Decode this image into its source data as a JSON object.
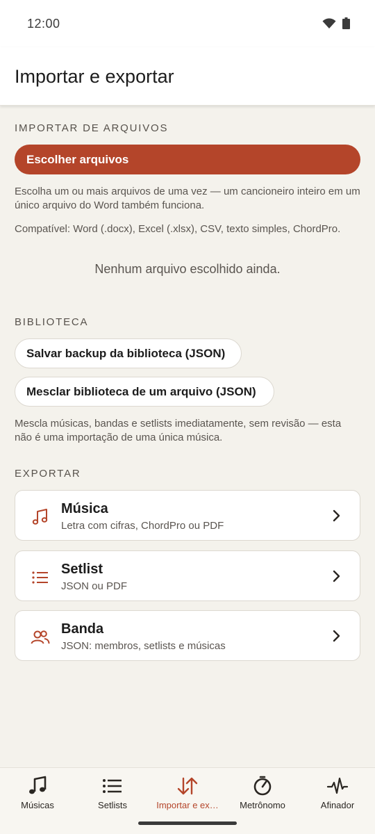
{
  "status": {
    "time": "12:00"
  },
  "appbar": {
    "title": "Importar e exportar"
  },
  "import": {
    "section_label": "IMPORTAR DE ARQUIVOS",
    "choose_button": "Escolher arquivos",
    "help_text": "Escolha um ou mais arquivos de uma vez — um cancioneiro inteiro em um único arquivo do Word também funciona.",
    "compat_text": "Compatível: Word (.docx), Excel (.xlsx), CSV, texto simples, ChordPro.",
    "empty_state": "Nenhum arquivo escolhido ainda."
  },
  "library": {
    "section_label": "BIBLIOTECA",
    "backup_button": "Salvar backup da biblioteca (JSON)",
    "merge_button": "Mesclar biblioteca de um arquivo (JSON)",
    "note": "Mescla músicas, bandas e setlists imediatamente, sem revisão — esta não é uma importação de uma única música."
  },
  "export": {
    "section_label": "EXPORTAR",
    "items": [
      {
        "title": "Música",
        "subtitle": "Letra com cifras, ChordPro ou PDF",
        "icon": "music-note-icon"
      },
      {
        "title": "Setlist",
        "subtitle": "JSON ou PDF",
        "icon": "list-icon"
      },
      {
        "title": "Banda",
        "subtitle": "JSON: membros, setlists e músicas",
        "icon": "people-icon"
      }
    ]
  },
  "nav": {
    "items": [
      {
        "label": "Músicas",
        "icon": "music-note-icon",
        "active": false
      },
      {
        "label": "Setlists",
        "icon": "list-icon",
        "active": false
      },
      {
        "label": "Importar e ex…",
        "icon": "import-export-icon",
        "active": true
      },
      {
        "label": "Metrônomo",
        "icon": "metronome-icon",
        "active": false
      },
      {
        "label": "Afinador",
        "icon": "tuner-icon",
        "active": false
      }
    ]
  },
  "colors": {
    "accent": "#b4452a",
    "background": "#f4f2ec",
    "surface": "#ffffff"
  }
}
